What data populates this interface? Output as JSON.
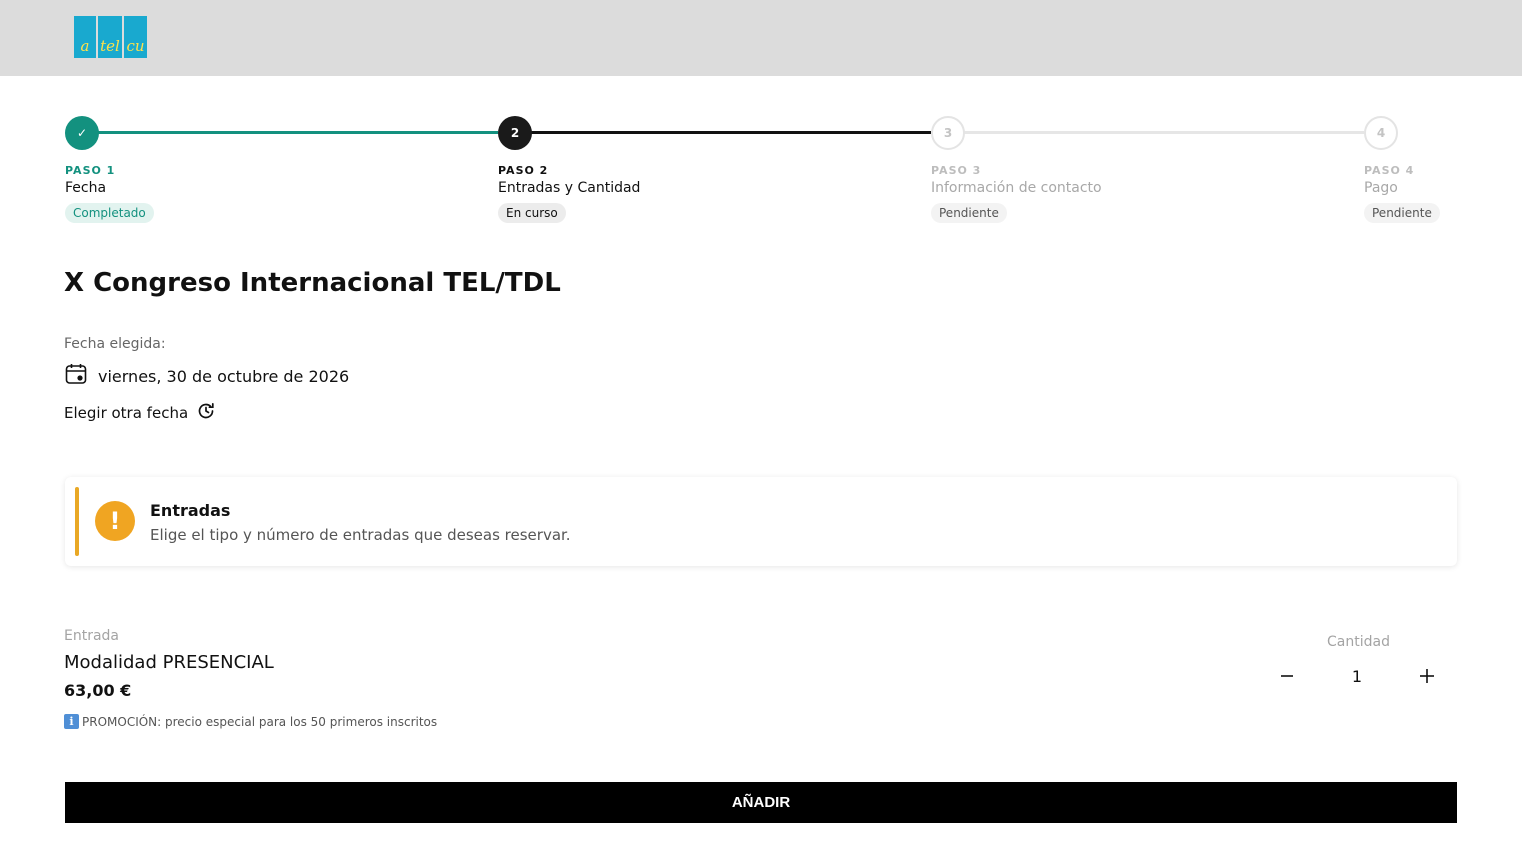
{
  "header": {
    "logo_letters": [
      "a",
      "tel",
      "cu"
    ]
  },
  "stepper": {
    "steps": [
      {
        "number": "✓",
        "paso": "PASO 1",
        "name": "Fecha",
        "status": "Completado"
      },
      {
        "number": "2",
        "paso": "PASO 2",
        "name": "Entradas y Cantidad",
        "status": "En curso"
      },
      {
        "number": "3",
        "paso": "PASO 3",
        "name": "Información de contacto",
        "status": "Pendiente"
      },
      {
        "number": "4",
        "paso": "PASO 4",
        "name": "Pago",
        "status": "Pendiente"
      }
    ]
  },
  "event": {
    "title": "X Congreso Internacional TEL/TDL",
    "date_label": "Fecha elegida:",
    "date_value": "viernes, 30 de octubre de 2026",
    "change_date": "Elegir otra fecha"
  },
  "notice": {
    "title": "Entradas",
    "text": "Elige el tipo y número de entradas que deseas reservar.",
    "icon_glyph": "!"
  },
  "ticket": {
    "label": "Entrada",
    "name": "Modalidad PRESENCIAL",
    "price": "63,00 €",
    "promo_icon": "i",
    "promo": "PROMOCIÓN: precio especial para los 50 primeros inscritos"
  },
  "quantity": {
    "label": "Cantidad",
    "value": "1"
  },
  "actions": {
    "add_label": "AÑADIR"
  },
  "colors": {
    "accent": "#13917f",
    "warning": "#f0a522",
    "header_bg": "#dcdcdc"
  }
}
